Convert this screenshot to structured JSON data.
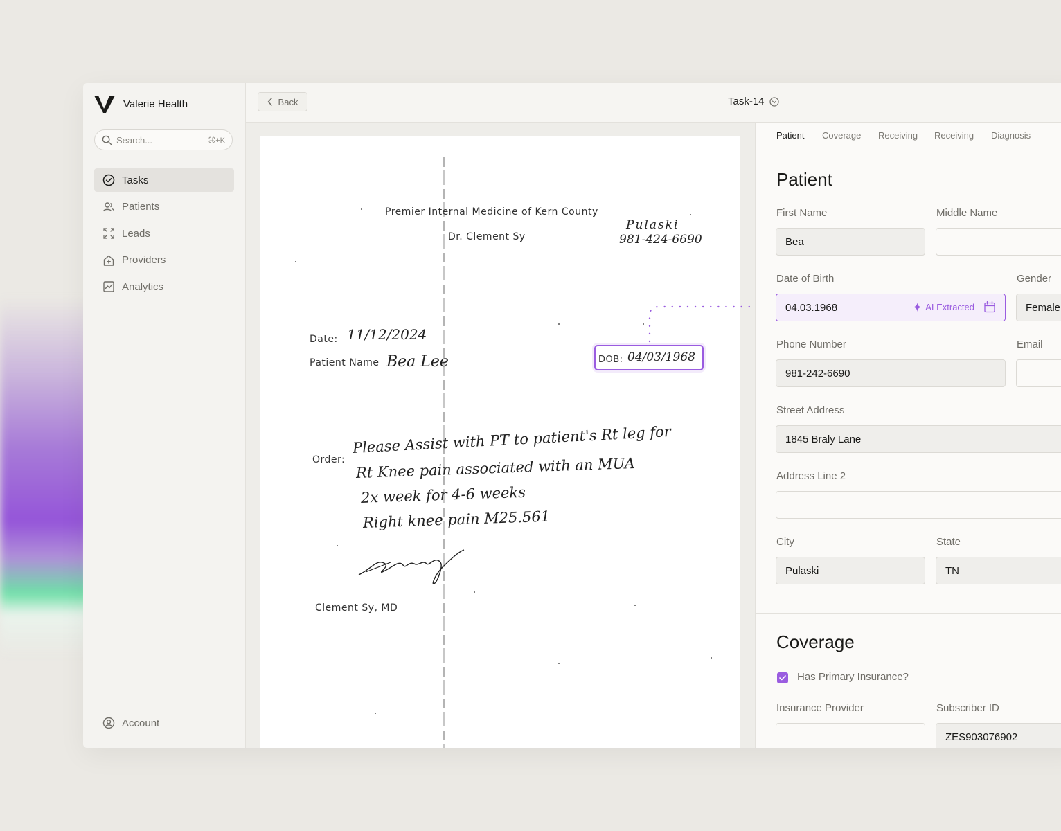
{
  "brand": {
    "name": "Valerie Health"
  },
  "search": {
    "placeholder": "Search...",
    "shortcut": "⌘+K"
  },
  "nav": {
    "items": [
      {
        "label": "Tasks",
        "icon": "check-circle-icon",
        "active": true
      },
      {
        "label": "Patients",
        "icon": "users-icon"
      },
      {
        "label": "Leads",
        "icon": "leads-icon"
      },
      {
        "label": "Providers",
        "icon": "providers-icon"
      },
      {
        "label": "Analytics",
        "icon": "chart-icon"
      }
    ],
    "account_label": "Account"
  },
  "header": {
    "back_label": "Back",
    "task_title": "Task-14"
  },
  "document": {
    "clinic": "Premier Internal Medicine of Kern County",
    "doctor": "Dr. Clement Sy",
    "city_note": "Pulaski",
    "phone_note": "981-424-6690",
    "date_label": "Date:",
    "date_value": "11/12/2024",
    "patient_label": "Patient Name",
    "patient_value": "Bea Lee",
    "dob_label": "DOB:",
    "dob_value": "04/03/1968",
    "order_label": "Order:",
    "order_lines": [
      "Please Assist with PT to patient's Rt leg for",
      "Rt Knee pain associated with an MUA",
      "2x week for 4-6 weeks",
      "Right knee pain M25.561"
    ],
    "signature_name": "Clement Sy, MD"
  },
  "form": {
    "tabs": [
      {
        "label": "Patient",
        "active": true
      },
      {
        "label": "Coverage"
      },
      {
        "label": "Receiving"
      },
      {
        "label": "Receiving"
      },
      {
        "label": "Diagnosis"
      }
    ],
    "patient_section": {
      "title": "Patient",
      "first_name": {
        "label": "First Name",
        "value": "Bea"
      },
      "middle_name": {
        "label": "Middle Name",
        "value": ""
      },
      "dob": {
        "label": "Date of Birth",
        "value": "04.03.1968",
        "ai_tag": "AI Extracted"
      },
      "gender": {
        "label": "Gender",
        "value": "Female"
      },
      "phone": {
        "label": "Phone Number",
        "value": "981-242-6690"
      },
      "email": {
        "label": "Email",
        "value": ""
      },
      "street": {
        "label": "Street Address",
        "value": "1845 Braly Lane"
      },
      "address2": {
        "label": "Address Line 2",
        "value": ""
      },
      "city": {
        "label": "City",
        "value": "Pulaski"
      },
      "state": {
        "label": "State",
        "value": "TN"
      }
    },
    "coverage_section": {
      "title": "Coverage",
      "has_primary": {
        "label": "Has Primary Insurance?",
        "checked": true
      },
      "provider": {
        "label": "Insurance Provider",
        "value": ""
      },
      "subscriber": {
        "label": "Subscriber ID",
        "value": "ZES903076902"
      }
    }
  },
  "colors": {
    "accent": "#9a5ce0",
    "background": "#ebe9e4",
    "sidebar": "#f4f3f0"
  }
}
